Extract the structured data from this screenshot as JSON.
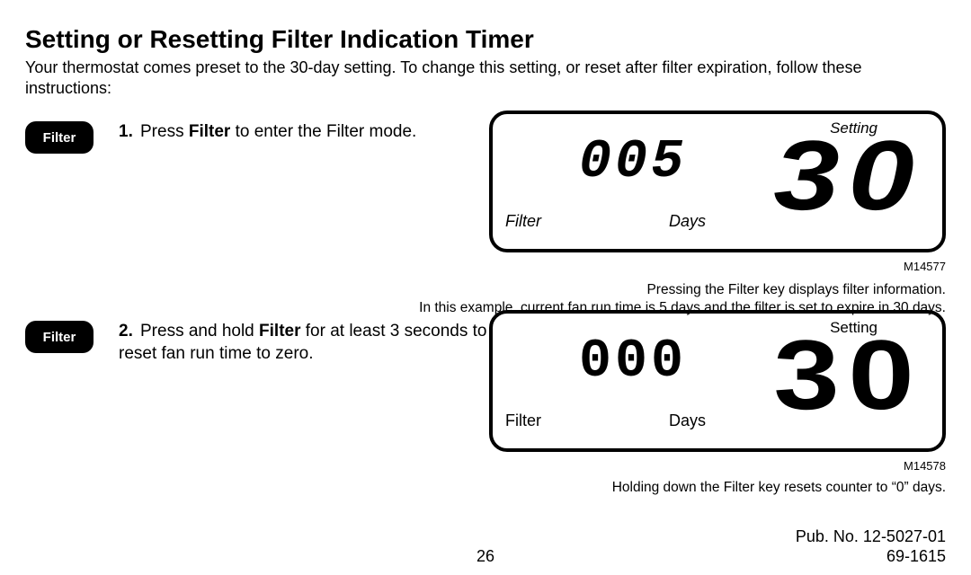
{
  "title": "Setting or Resetting Filter Indication Timer",
  "intro": "Your thermostat comes preset to the 30-day setting. To change this setting, or reset after filter expiration, follow these instructions:",
  "button_label": "Filter",
  "steps": [
    {
      "num": "1.",
      "text_before": "Press ",
      "bold": "Filter",
      "text_after": " to enter the Filter mode.",
      "lcd": {
        "setting": "Setting",
        "filter": "Filter",
        "days": "Days",
        "small_num": "005",
        "big_num": "30"
      },
      "fig_id": "M14577",
      "caption_line1": "Pressing the Filter key displays filter information.",
      "caption_line2": "In this example, current fan run time is 5 days and the filter is set to expire in 30 days."
    },
    {
      "num": "2.",
      "text_before": "Press and hold ",
      "bold": "Filter",
      "text_after": " for at least 3 seconds to reset fan run time to zero.",
      "lcd": {
        "setting": "Setting",
        "filter": "Filter",
        "days": "Days",
        "small_num": "000",
        "big_num": "30"
      },
      "fig_id": "M14578",
      "caption_line1": "Holding down the Filter key resets counter to “0” days.",
      "caption_line2": ""
    }
  ],
  "footer": {
    "page_no": "26",
    "pub": "Pub. No. 12-5027-01",
    "doc": "69-1615"
  }
}
